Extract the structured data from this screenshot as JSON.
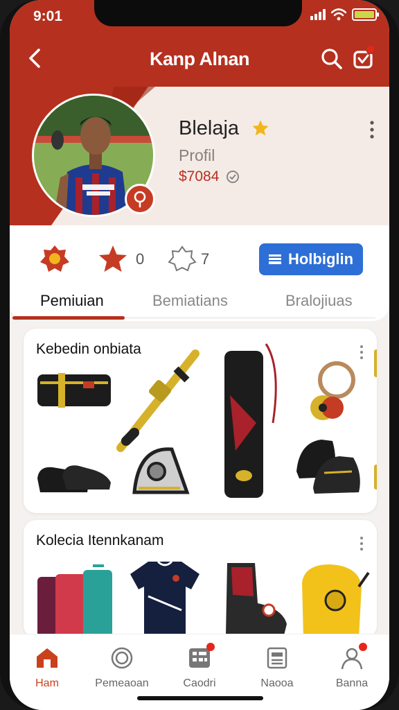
{
  "status": {
    "time": "9:01"
  },
  "header": {
    "title": "Kanp Alnan"
  },
  "profile": {
    "name": "Blelaja",
    "subtitle": "Profil",
    "price": "$7084"
  },
  "stats": {
    "item2_value": "0",
    "item3_value": "7"
  },
  "follow_button": {
    "label": "Holbiglin"
  },
  "tabs": [
    {
      "label": "Pemiuian",
      "active": true
    },
    {
      "label": "Bemiatians",
      "active": false
    },
    {
      "label": "Bralojiuas",
      "active": false
    }
  ],
  "sections": [
    {
      "title": "Kebedin onbiata"
    },
    {
      "title": "Kolecia Itennkanam"
    }
  ],
  "nav": [
    {
      "label": "Ham",
      "icon": "home-icon",
      "active": true
    },
    {
      "label": "Pemeaoan",
      "icon": "circle-icon",
      "active": false
    },
    {
      "label": "Caodri",
      "icon": "calculator-icon",
      "active": false
    },
    {
      "label": "Naooa",
      "icon": "register-icon",
      "active": false
    },
    {
      "label": "Banna",
      "icon": "person-icon",
      "active": false
    }
  ],
  "colors": {
    "brand": "#b5301f",
    "accent_blue": "#2d6fd6",
    "notification": "#e7261b"
  }
}
